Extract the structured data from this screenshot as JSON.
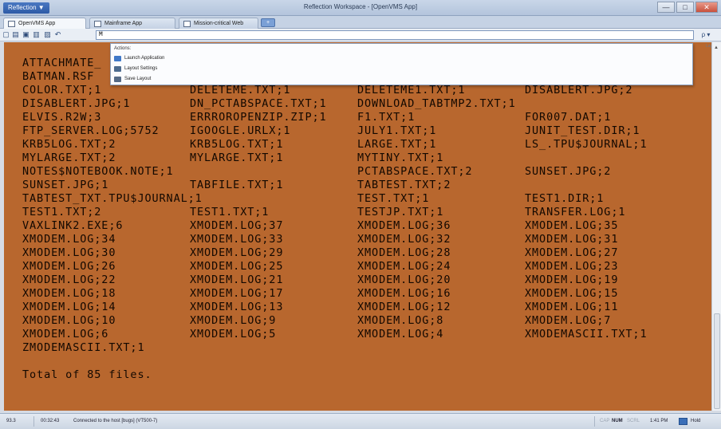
{
  "window": {
    "app_menu": "Reflection ▼",
    "title": "Reflection Workspace - [OpenVMS App]",
    "min": "—",
    "max": "□",
    "close": "✕"
  },
  "tabs": [
    {
      "label": "OpenVMS App"
    },
    {
      "label": "Mainframe App"
    },
    {
      "label": "Mission-critical Web App"
    }
  ],
  "new_tab": "+",
  "search": {
    "value": "M",
    "button": "ρ ▾"
  },
  "hint": "Layout",
  "actions_popup": {
    "title": "Actions:",
    "items": [
      {
        "label": "Launch Application"
      },
      {
        "label": "Layout Settings"
      },
      {
        "label": "Save Layout"
      }
    ]
  },
  "terminal": {
    "partial_lines": [
      "ATTACHMATE_",
      "BATMAN.RSF"
    ],
    "rows": [
      [
        "COLOR.TXT;1",
        "DELETEME.TXT;1",
        "DELETEME1.TXT;1",
        "DISABLERT.JPG;2"
      ],
      [
        "DISABLERT.JPG;1",
        "DN_PCTABSPACE.TXT;1",
        "DOWNLOAD_TABTMP2.TXT;1",
        ""
      ],
      [
        "ELVIS.R2W;3",
        "ERRROROPENZIP.ZIP;1",
        "F1.TXT;1",
        "FOR007.DAT;1"
      ],
      [
        "FTP_SERVER.LOG;5752",
        "IGOOGLE.URLX;1",
        "JULY1.TXT;1",
        "JUNIT_TEST.DIR;1"
      ],
      [
        "KRB5LOG.TXT;2",
        "KRB5LOG.TXT;1",
        "LARGE.TXT;1",
        "LS_.TPU$JOURNAL;1"
      ],
      [
        "MYLARGE.TXT;2",
        "MYLARGE.TXT;1",
        "MYTINY.TXT;1",
        ""
      ],
      [
        "NOTES$NOTEBOOK.NOTE;1",
        "",
        "PCTABSPACE.TXT;2",
        "SUNSET.JPG;2"
      ],
      [
        "SUNSET.JPG;1",
        "TABFILE.TXT;1",
        "TABTEST.TXT;2",
        ""
      ],
      [
        "TABTEST_TXT.TPU$JOURNAL;1",
        "",
        "TEST.TXT;1",
        "TEST1.DIR;1"
      ],
      [
        "TEST1.TXT;2",
        "TEST1.TXT;1",
        "TESTJP.TXT;1",
        "TRANSFER.LOG;1"
      ],
      [
        "VAXLINK2.EXE;6",
        "XMODEM.LOG;37",
        "XMODEM.LOG;36",
        "XMODEM.LOG;35"
      ],
      [
        "XMODEM.LOG;34",
        "XMODEM.LOG;33",
        "XMODEM.LOG;32",
        "XMODEM.LOG;31"
      ],
      [
        "XMODEM.LOG;30",
        "XMODEM.LOG;29",
        "XMODEM.LOG;28",
        "XMODEM.LOG;27"
      ],
      [
        "XMODEM.LOG;26",
        "XMODEM.LOG;25",
        "XMODEM.LOG;24",
        "XMODEM.LOG;23"
      ],
      [
        "XMODEM.LOG;22",
        "XMODEM.LOG;21",
        "XMODEM.LOG;20",
        "XMODEM.LOG;19"
      ],
      [
        "XMODEM.LOG;18",
        "XMODEM.LOG;17",
        "XMODEM.LOG;16",
        "XMODEM.LOG;15"
      ],
      [
        "XMODEM.LOG;14",
        "XMODEM.LOG;13",
        "XMODEM.LOG;12",
        "XMODEM.LOG;11"
      ],
      [
        "XMODEM.LOG;10",
        "XMODEM.LOG;9",
        "XMODEM.LOG;8",
        "XMODEM.LOG;7"
      ],
      [
        "XMODEM.LOG;6",
        "XMODEM.LOG;5",
        "XMODEM.LOG;4",
        "XMODEMASCII.TXT;1"
      ],
      [
        "ZMODEMASCII.TXT;1",
        "",
        "",
        ""
      ]
    ],
    "total": "Total of 85 files."
  },
  "status": {
    "position": "93.3",
    "time_elapsed": "00:32:43",
    "message": "Connected to the host [bugs] (VT500-7)",
    "cap": "CAP",
    "num": "NUM",
    "scrl": "SCRL",
    "clock": "1:41 PM",
    "hold": "Hold"
  },
  "colors": {
    "terminal_bg": "#b8672e",
    "terminal_fg": "#130800"
  }
}
